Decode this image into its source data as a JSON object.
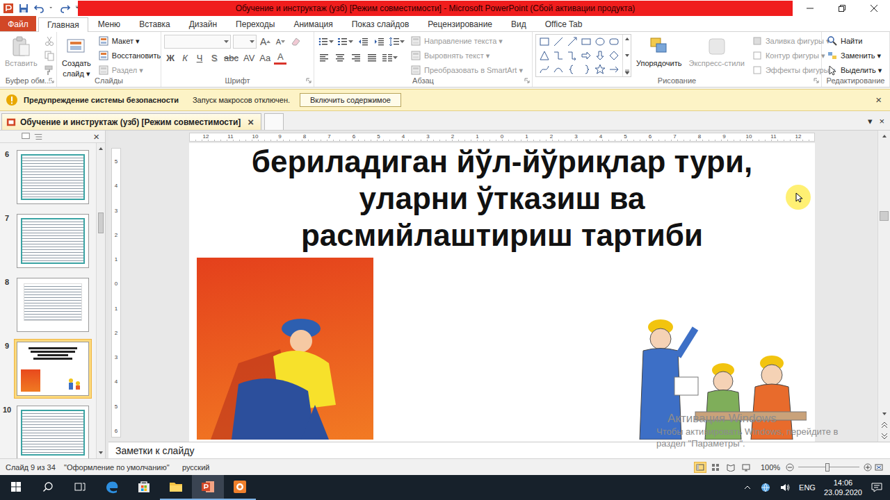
{
  "window": {
    "title": "Обучение и инструктаж (узб) [Режим совместимости]  -  Microsoft PowerPoint (Сбой активации продукта)"
  },
  "ribbon_tabs": [
    {
      "label": "Файл",
      "selected": false,
      "kind": "file"
    },
    {
      "label": "Главная",
      "selected": true,
      "kind": "tab"
    },
    {
      "label": "Меню",
      "selected": false,
      "kind": "tab"
    },
    {
      "label": "Вставка",
      "selected": false,
      "kind": "tab"
    },
    {
      "label": "Дизайн",
      "selected": false,
      "kind": "tab"
    },
    {
      "label": "Переходы",
      "selected": false,
      "kind": "tab"
    },
    {
      "label": "Анимация",
      "selected": false,
      "kind": "tab"
    },
    {
      "label": "Показ слайдов",
      "selected": false,
      "kind": "tab"
    },
    {
      "label": "Рецензирование",
      "selected": false,
      "kind": "tab"
    },
    {
      "label": "Вид",
      "selected": false,
      "kind": "tab"
    },
    {
      "label": "Office Tab",
      "selected": false,
      "kind": "tab"
    }
  ],
  "clipboard": {
    "label": "Буфер обм...",
    "paste": "Вставить",
    "disabled": true
  },
  "slides_group": {
    "label": "Слайды",
    "new_slide": [
      "Создать",
      "слайд ▾"
    ],
    "items": [
      {
        "label": "Макет ▾",
        "disabled": false
      },
      {
        "label": "Восстановить",
        "disabled": false
      },
      {
        "label": "Раздел ▾",
        "disabled": true
      }
    ]
  },
  "font_group": {
    "label": "Шрифт",
    "disabled": true,
    "size_buttons": [
      {
        "label": "A",
        "kind": "grow"
      },
      {
        "label": "A",
        "kind": "shrink"
      }
    ],
    "buttons": [
      {
        "label": "Ж",
        "kind": "bold"
      },
      {
        "label": "К",
        "kind": "italic"
      },
      {
        "label": "Ч",
        "kind": "underline"
      },
      {
        "label": "S",
        "kind": "shadow"
      },
      {
        "label": "abc",
        "kind": "strike"
      },
      {
        "label": "AV",
        "kind": "spacing"
      },
      {
        "label": "Aa",
        "kind": "case"
      },
      {
        "label": "A",
        "kind": "color"
      }
    ]
  },
  "paragraph_group": {
    "label": "Абзац",
    "items": [
      {
        "label": "Направление текста ▾",
        "disabled": true
      },
      {
        "label": "Выровнять текст ▾",
        "disabled": true
      },
      {
        "label": "Преобразовать в SmartArt ▾",
        "disabled": true
      }
    ]
  },
  "drawing_group": {
    "label": "Рисование",
    "arrange": {
      "label": "Упорядочить",
      "disabled": false
    },
    "quick_styles": {
      "label": "Экспресс-стили",
      "disabled": true
    },
    "items": [
      {
        "label": "Заливка фигуры ▾",
        "disabled": true
      },
      {
        "label": "Контур фигуры ▾",
        "disabled": true
      },
      {
        "label": "Эффекты фигуры ▾",
        "disabled": true
      }
    ]
  },
  "editing_group": {
    "label": "Редактирование",
    "items": [
      {
        "label": "Найти",
        "disabled": false
      },
      {
        "label": "Заменить ▾",
        "disabled": false
      },
      {
        "label": "Выделить ▾",
        "disabled": false
      }
    ]
  },
  "security_bar": {
    "title": "Предупреждение системы безопасности",
    "message": "Запуск макросов отключен.",
    "button": "Включить содержимое",
    "close": "×"
  },
  "document_tabs": [
    {
      "label": "Обучение и инструктаж (узб) [Режим совместимости]",
      "selected": true,
      "close": "×"
    },
    {
      "label": "",
      "selected": false,
      "close": ""
    }
  ],
  "tab_bar_buttons": [
    "▾",
    "×"
  ],
  "slide_panel": {
    "close": "×",
    "scroll": {
      "level": 0.2
    }
  },
  "thumbnails": [
    {
      "number": "6",
      "selected": false,
      "kind": "framed"
    },
    {
      "number": "7",
      "selected": false,
      "kind": "framed"
    },
    {
      "number": "8",
      "selected": false,
      "kind": "plain"
    },
    {
      "number": "9",
      "selected": true,
      "kind": "title"
    },
    {
      "number": "10",
      "selected": false,
      "kind": "framed"
    }
  ],
  "horizontal_ruler": [
    "12",
    "11",
    "10",
    "9",
    "8",
    "7",
    "6",
    "5",
    "4",
    "3",
    "2",
    "1",
    "0",
    "1",
    "2",
    "3",
    "4",
    "5",
    "6",
    "7",
    "8",
    "9",
    "10",
    "11",
    "12"
  ],
  "vertical_ruler": [
    "5",
    "4",
    "3",
    "2",
    "1",
    "0",
    "1",
    "2",
    "3",
    "4",
    "5",
    "6"
  ],
  "slide": {
    "title_lines": [
      "бериладиган йўл-йўриқлар тури,",
      "уларни ўтказиш ва",
      "расмийлаштириш тартиби"
    ]
  },
  "editor_scroll": {
    "level": 0.26
  },
  "notes": {
    "placeholder": "Заметки к слайду"
  },
  "status_bar": {
    "slide": "Слайд 9 из 34",
    "theme": "\"Оформление по умолчанию\"",
    "language": "русский",
    "zoom": "100%",
    "zoom_level": 0.48
  },
  "watermark": {
    "lines": [
      "Активация Windows",
      "Чтобы активировать Windows, перейдите в",
      "раздел \"Параметры\"."
    ]
  },
  "taskbar": {
    "apps": [
      {
        "kind": "edge",
        "selected": false,
        "open": false
      },
      {
        "kind": "store",
        "selected": false,
        "open": false
      },
      {
        "kind": "explorer",
        "selected": false,
        "open": true
      },
      {
        "kind": "powerpoint",
        "selected": true,
        "open": true
      },
      {
        "kind": "recorder",
        "selected": false,
        "open": true
      }
    ],
    "language": "ENG",
    "time": "14:06",
    "date": "23.09.2020"
  }
}
